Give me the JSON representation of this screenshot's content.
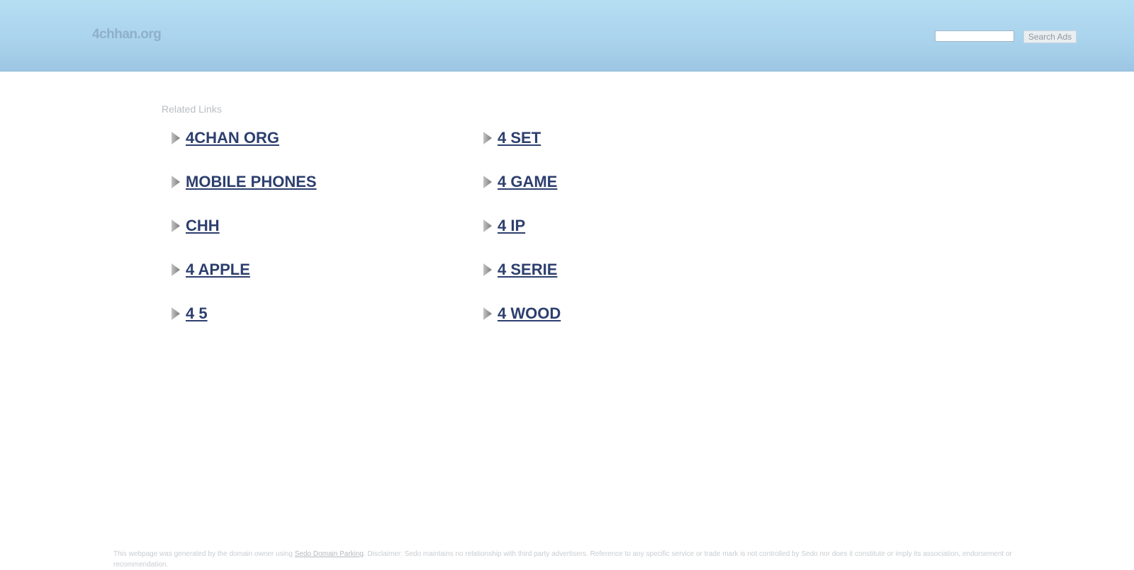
{
  "header": {
    "site_name": "4chhan.org",
    "search": {
      "placeholder": "",
      "value": "",
      "button_label": "Search Ads"
    }
  },
  "main": {
    "related_title": "Related Links",
    "links_left": [
      {
        "label": "4CHAN ORG"
      },
      {
        "label": "MOBILE PHONES"
      },
      {
        "label": "CHH"
      },
      {
        "label": "4 APPLE"
      },
      {
        "label": "4 5"
      }
    ],
    "links_right": [
      {
        "label": "4 SET"
      },
      {
        "label": "4 GAME"
      },
      {
        "label": "4 IP"
      },
      {
        "label": "4 SERIE"
      },
      {
        "label": "4 WOOD"
      }
    ]
  },
  "footer": {
    "prefix": "This webpage was generated by the domain owner using ",
    "link_label": "Sedo Domain Parking",
    "disclaimer": ". Disclaimer: Sedo maintains no relationship with third party advertisers. Reference to any specific service or trade mark is not controlled by Sedo nor does it constitute or imply its association, endorsement or recommendation."
  },
  "colors": {
    "header_bg": "#b5def3",
    "link": "#2d3f6e",
    "site_name": "#8fb0c8"
  },
  "icons": {
    "link_bullet": "arrow-right-icon"
  }
}
